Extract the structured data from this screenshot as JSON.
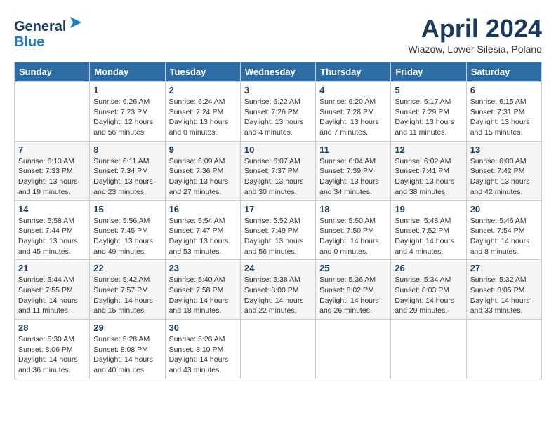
{
  "header": {
    "logo_line1": "General",
    "logo_line2": "Blue",
    "month_title": "April 2024",
    "location": "Wiazow, Lower Silesia, Poland"
  },
  "days_of_week": [
    "Sunday",
    "Monday",
    "Tuesday",
    "Wednesday",
    "Thursday",
    "Friday",
    "Saturday"
  ],
  "weeks": [
    [
      {
        "day": "",
        "info": ""
      },
      {
        "day": "1",
        "info": "Sunrise: 6:26 AM\nSunset: 7:23 PM\nDaylight: 12 hours\nand 56 minutes."
      },
      {
        "day": "2",
        "info": "Sunrise: 6:24 AM\nSunset: 7:24 PM\nDaylight: 13 hours\nand 0 minutes."
      },
      {
        "day": "3",
        "info": "Sunrise: 6:22 AM\nSunset: 7:26 PM\nDaylight: 13 hours\nand 4 minutes."
      },
      {
        "day": "4",
        "info": "Sunrise: 6:20 AM\nSunset: 7:28 PM\nDaylight: 13 hours\nand 7 minutes."
      },
      {
        "day": "5",
        "info": "Sunrise: 6:17 AM\nSunset: 7:29 PM\nDaylight: 13 hours\nand 11 minutes."
      },
      {
        "day": "6",
        "info": "Sunrise: 6:15 AM\nSunset: 7:31 PM\nDaylight: 13 hours\nand 15 minutes."
      }
    ],
    [
      {
        "day": "7",
        "info": "Sunrise: 6:13 AM\nSunset: 7:33 PM\nDaylight: 13 hours\nand 19 minutes."
      },
      {
        "day": "8",
        "info": "Sunrise: 6:11 AM\nSunset: 7:34 PM\nDaylight: 13 hours\nand 23 minutes."
      },
      {
        "day": "9",
        "info": "Sunrise: 6:09 AM\nSunset: 7:36 PM\nDaylight: 13 hours\nand 27 minutes."
      },
      {
        "day": "10",
        "info": "Sunrise: 6:07 AM\nSunset: 7:37 PM\nDaylight: 13 hours\nand 30 minutes."
      },
      {
        "day": "11",
        "info": "Sunrise: 6:04 AM\nSunset: 7:39 PM\nDaylight: 13 hours\nand 34 minutes."
      },
      {
        "day": "12",
        "info": "Sunrise: 6:02 AM\nSunset: 7:41 PM\nDaylight: 13 hours\nand 38 minutes."
      },
      {
        "day": "13",
        "info": "Sunrise: 6:00 AM\nSunset: 7:42 PM\nDaylight: 13 hours\nand 42 minutes."
      }
    ],
    [
      {
        "day": "14",
        "info": "Sunrise: 5:58 AM\nSunset: 7:44 PM\nDaylight: 13 hours\nand 45 minutes."
      },
      {
        "day": "15",
        "info": "Sunrise: 5:56 AM\nSunset: 7:45 PM\nDaylight: 13 hours\nand 49 minutes."
      },
      {
        "day": "16",
        "info": "Sunrise: 5:54 AM\nSunset: 7:47 PM\nDaylight: 13 hours\nand 53 minutes."
      },
      {
        "day": "17",
        "info": "Sunrise: 5:52 AM\nSunset: 7:49 PM\nDaylight: 13 hours\nand 56 minutes."
      },
      {
        "day": "18",
        "info": "Sunrise: 5:50 AM\nSunset: 7:50 PM\nDaylight: 14 hours\nand 0 minutes."
      },
      {
        "day": "19",
        "info": "Sunrise: 5:48 AM\nSunset: 7:52 PM\nDaylight: 14 hours\nand 4 minutes."
      },
      {
        "day": "20",
        "info": "Sunrise: 5:46 AM\nSunset: 7:54 PM\nDaylight: 14 hours\nand 8 minutes."
      }
    ],
    [
      {
        "day": "21",
        "info": "Sunrise: 5:44 AM\nSunset: 7:55 PM\nDaylight: 14 hours\nand 11 minutes."
      },
      {
        "day": "22",
        "info": "Sunrise: 5:42 AM\nSunset: 7:57 PM\nDaylight: 14 hours\nand 15 minutes."
      },
      {
        "day": "23",
        "info": "Sunrise: 5:40 AM\nSunset: 7:58 PM\nDaylight: 14 hours\nand 18 minutes."
      },
      {
        "day": "24",
        "info": "Sunrise: 5:38 AM\nSunset: 8:00 PM\nDaylight: 14 hours\nand 22 minutes."
      },
      {
        "day": "25",
        "info": "Sunrise: 5:36 AM\nSunset: 8:02 PM\nDaylight: 14 hours\nand 26 minutes."
      },
      {
        "day": "26",
        "info": "Sunrise: 5:34 AM\nSunset: 8:03 PM\nDaylight: 14 hours\nand 29 minutes."
      },
      {
        "day": "27",
        "info": "Sunrise: 5:32 AM\nSunset: 8:05 PM\nDaylight: 14 hours\nand 33 minutes."
      }
    ],
    [
      {
        "day": "28",
        "info": "Sunrise: 5:30 AM\nSunset: 8:06 PM\nDaylight: 14 hours\nand 36 minutes."
      },
      {
        "day": "29",
        "info": "Sunrise: 5:28 AM\nSunset: 8:08 PM\nDaylight: 14 hours\nand 40 minutes."
      },
      {
        "day": "30",
        "info": "Sunrise: 5:26 AM\nSunset: 8:10 PM\nDaylight: 14 hours\nand 43 minutes."
      },
      {
        "day": "",
        "info": ""
      },
      {
        "day": "",
        "info": ""
      },
      {
        "day": "",
        "info": ""
      },
      {
        "day": "",
        "info": ""
      }
    ]
  ]
}
